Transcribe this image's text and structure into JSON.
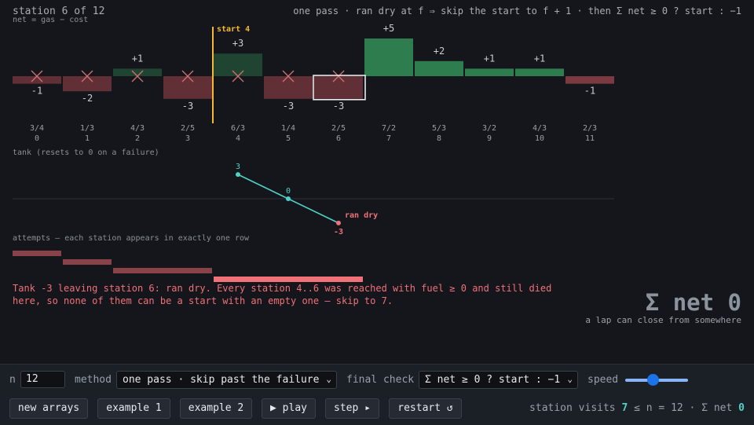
{
  "header": {
    "title": "station 6 of 12",
    "subtitle": "net = gas − cost",
    "rule": "one pass · ran dry at f ⇒ skip the start to f + 1 · then Σ net ≥ 0 ? start : −1"
  },
  "stations": [
    {
      "index": "0",
      "ratio": "3/4",
      "net": -1,
      "net_label": "-1",
      "crossed": true
    },
    {
      "index": "1",
      "ratio": "1/3",
      "net": -2,
      "net_label": "-2",
      "crossed": true
    },
    {
      "index": "2",
      "ratio": "4/3",
      "net": 1,
      "net_label": "+1",
      "crossed": true
    },
    {
      "index": "3",
      "ratio": "2/5",
      "net": -3,
      "net_label": "-3",
      "crossed": true
    },
    {
      "index": "4",
      "ratio": "6/3",
      "net": 3,
      "net_label": "+3",
      "crossed": true
    },
    {
      "index": "5",
      "ratio": "1/4",
      "net": -3,
      "net_label": "-3",
      "crossed": true
    },
    {
      "index": "6",
      "ratio": "2/5",
      "net": -3,
      "net_label": "-3",
      "crossed": true
    },
    {
      "index": "7",
      "ratio": "7/2",
      "net": 5,
      "net_label": "+5",
      "crossed": false
    },
    {
      "index": "8",
      "ratio": "5/3",
      "net": 2,
      "net_label": "+2",
      "crossed": false
    },
    {
      "index": "9",
      "ratio": "3/2",
      "net": 1,
      "net_label": "+1",
      "crossed": false
    },
    {
      "index": "10",
      "ratio": "4/3",
      "net": 1,
      "net_label": "+1",
      "crossed": false
    },
    {
      "index": "11",
      "ratio": "2/3",
      "net": -1,
      "net_label": "-1",
      "crossed": false
    }
  ],
  "start_marker": {
    "label": "start 4",
    "station": 4
  },
  "current_station": 6,
  "tank": {
    "label": "tank  (resets to 0 on a failure)",
    "points": [
      {
        "station": 4,
        "value": 3,
        "label": "3"
      },
      {
        "station": 5,
        "value": 0,
        "label": "0"
      },
      {
        "station": 6,
        "value": -3,
        "label": "-3"
      }
    ],
    "failure_label": "ran dry"
  },
  "attempts": {
    "label": "attempts — each station appears in exactly one row",
    "rows": [
      {
        "from": 0,
        "to": 0
      },
      {
        "from": 1,
        "to": 1
      },
      {
        "from": 2,
        "to": 3
      },
      {
        "from": 4,
        "to": 6,
        "active": true
      }
    ]
  },
  "message": "Tank -3 leaving station 6: ran dry. Every station 4..6 was reached with fuel ≥ 0 and still died here, so none of them can be a start with an empty one — skip to 7.",
  "summary": {
    "title": "Σ net 0",
    "subtitle": "a lap can close from somewhere"
  },
  "controls": {
    "n_label": "n",
    "n_value": "12",
    "method_label": "method",
    "method_value": "one pass · skip past the failure",
    "final_label": "final check",
    "final_value": "Σ net ≥ 0 ? start : −1",
    "speed_label": "speed",
    "speed_value": 0.4,
    "buttons": {
      "new_arrays": "new arrays",
      "example1": "example 1",
      "example2": "example 2",
      "play": "▶ play",
      "step": "step ▸",
      "restart": "restart ↺"
    }
  },
  "status": {
    "prefix": "station visits ",
    "visits": "7",
    "mid": " ≤ n = 12 · Σ net ",
    "sum": "0"
  },
  "colors": {
    "positive": "#2e7d4f",
    "negative": "#7a3a40",
    "accent_start": "#f5b82e",
    "tank_line": "#4fd1c5",
    "failure": "#f07178"
  }
}
